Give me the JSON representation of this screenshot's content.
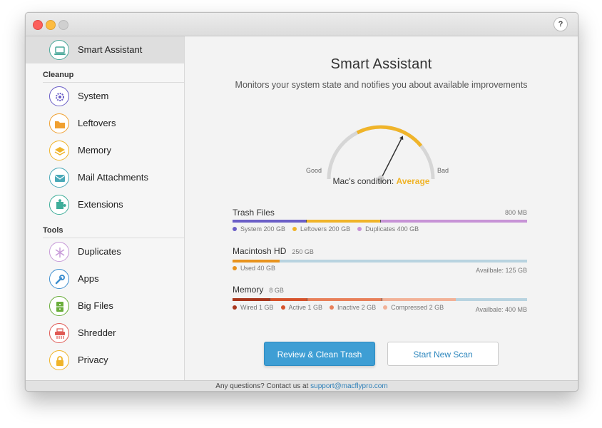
{
  "window": {
    "help_label": "?"
  },
  "sidebar": {
    "top_item": {
      "label": "Smart Assistant",
      "icon": "laptop-icon",
      "color": "#4aa99a"
    },
    "sections": [
      {
        "title": "Cleanup",
        "items": [
          {
            "label": "System",
            "icon": "gear-icon",
            "color": "#6b5fc7"
          },
          {
            "label": "Leftovers",
            "icon": "folder-icon",
            "color": "#f0a030"
          },
          {
            "label": "Memory",
            "icon": "layers-icon",
            "color": "#f0b429"
          },
          {
            "label": "Mail Attachments",
            "icon": "mail-icon",
            "color": "#4aa9b8"
          },
          {
            "label": "Extensions",
            "icon": "puzzle-icon",
            "color": "#3fae9a"
          }
        ]
      },
      {
        "title": "Tools",
        "items": [
          {
            "label": "Duplicates",
            "icon": "snowflake-icon",
            "color": "#c79ad8"
          },
          {
            "label": "Apps",
            "icon": "wrench-icon",
            "color": "#3f8fcf"
          },
          {
            "label": "Big Files",
            "icon": "cabinet-icon",
            "color": "#6aae3c"
          },
          {
            "label": "Shredder",
            "icon": "shredder-icon",
            "color": "#e05a55"
          },
          {
            "label": "Privacy",
            "icon": "lock-icon",
            "color": "#f0b429"
          }
        ]
      }
    ]
  },
  "main": {
    "title": "Smart Assistant",
    "subtitle": "Monitors your system state and notifies you about available improvements",
    "gauge": {
      "good_label": "Good",
      "bad_label": "Bad",
      "condition_label": "Mac's condition:",
      "condition_value": "Average",
      "level": 0.65
    },
    "trash": {
      "title": "Trash Files",
      "total": "800 MB",
      "segments": [
        {
          "label": "System 200 GB",
          "value": 200,
          "color": "#6b5fc7"
        },
        {
          "label": "Leftovers 200 GB",
          "value": 200,
          "color": "#f0b429"
        },
        {
          "label": "Duplicates 400 GB",
          "value": 400,
          "color": "#c793d6"
        }
      ]
    },
    "hd": {
      "title": "Macintosh HD",
      "size": "250 GB",
      "used_label": "Used 40 GB",
      "used_value": 40,
      "total_value": 250,
      "used_color": "#e8931e",
      "available": "Availbale: 125 GB"
    },
    "memory": {
      "title": "Memory",
      "size": "8 GB",
      "segments": [
        {
          "label": "Wired 1 GB",
          "value": 1,
          "color": "#a8371d"
        },
        {
          "label": "Active 1 GB",
          "value": 1,
          "color": "#d6532c"
        },
        {
          "label": "Inactive 2 GB",
          "value": 2,
          "color": "#e8805a"
        },
        {
          "label": "Compressed 2 GB",
          "value": 2,
          "color": "#f2b197"
        }
      ],
      "total_value": 8,
      "available": "Availbale: 400 MB"
    },
    "buttons": {
      "primary": "Review & Clean Trash",
      "secondary": "Start New Scan"
    }
  },
  "footer": {
    "text": "Any questions? Contact us at",
    "email": "support@macflypro.com"
  }
}
